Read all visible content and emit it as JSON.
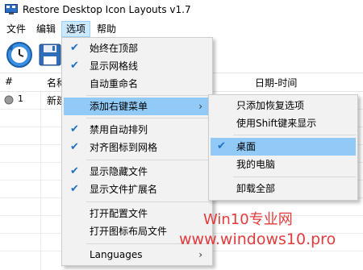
{
  "window": {
    "title": "Restore Desktop Icon Layouts v1.7"
  },
  "menubar": {
    "items": [
      "文件",
      "编辑",
      "选项",
      "帮助"
    ]
  },
  "table": {
    "headers": [
      "#",
      "名称",
      "日期-时间"
    ],
    "rows": [
      {
        "index": "1",
        "name": "新建"
      }
    ]
  },
  "options_menu": {
    "items": [
      {
        "label": "始终在顶部",
        "checked": true
      },
      {
        "label": "显示网格线",
        "checked": true
      },
      {
        "label": "自动重命名",
        "checked": false
      },
      {
        "label": "添加右键菜单",
        "checked": false,
        "submenu": true,
        "highlighted": true
      },
      {
        "label": "禁用自动排列",
        "checked": true
      },
      {
        "label": "对齐图标到网格",
        "checked": true
      },
      {
        "label": "显示隐藏文件",
        "checked": true
      },
      {
        "label": "显示文件扩展名",
        "checked": true
      },
      {
        "label": "打开配置文件",
        "checked": false
      },
      {
        "label": "打开图标布局文件",
        "checked": false
      },
      {
        "label": "Languages",
        "checked": false,
        "submenu": true
      }
    ]
  },
  "context_submenu": {
    "items": [
      {
        "label": "只添加恢复选项",
        "checked": false
      },
      {
        "label": "使用Shift键来显示",
        "checked": false
      },
      {
        "label": "桌面",
        "checked": true,
        "highlighted": true
      },
      {
        "label": "我的电脑",
        "checked": false
      },
      {
        "label": "卸载全部",
        "checked": false
      }
    ]
  },
  "watermark": {
    "line1": "Win10专业网",
    "line2": "www.windows10.pro"
  },
  "icons": {
    "check": "checkmark-icon",
    "arrow": "chevron-right-icon"
  },
  "colors": {
    "highlight": "#91c9f7",
    "menu_bg": "#f2f2f2",
    "watermark": "#e23b3b"
  }
}
